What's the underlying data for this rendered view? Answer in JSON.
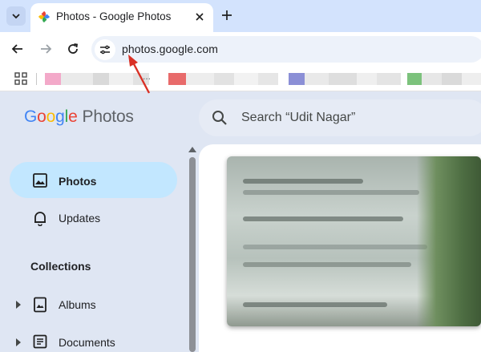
{
  "browser": {
    "tab_title": "Photos - Google Photos",
    "url": "photos.google.com",
    "bookmark_overflow": "..."
  },
  "app": {
    "logo_google": [
      "G",
      "o",
      "o",
      "g",
      "l",
      "e"
    ],
    "logo_product": "Photos",
    "search_placeholder": "Search “Udit Nagar”"
  },
  "sidebar": {
    "items": [
      {
        "label": "Photos",
        "icon": "photo-icon",
        "active": true
      },
      {
        "label": "Updates",
        "icon": "bell-icon",
        "active": false
      }
    ],
    "collections_title": "Collections",
    "collections": [
      {
        "label": "Albums",
        "icon": "album-icon"
      },
      {
        "label": "Documents",
        "icon": "document-icon"
      }
    ]
  },
  "colors": {
    "tabstrip": "#d3e3fd",
    "active_nav": "#c2e7ff",
    "annotation_arrow": "#d93025"
  }
}
